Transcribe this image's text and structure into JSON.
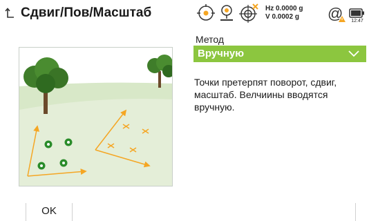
{
  "header": {
    "title": "Сдвиг/Пов/Масштаб",
    "hz_line": "Hz 0.0000 g",
    "v_line": "V  0.0002 g",
    "battery_time": "12:47",
    "icons": [
      "back-icon",
      "level-bubble-icon",
      "reflector-icon",
      "target-lock-icon",
      "at-signal-icon",
      "battery-icon"
    ]
  },
  "method": {
    "label": "Метод",
    "value": "Вручную"
  },
  "description": "Точки претерпят поворот, сдвиг, масштаб. Велчиины вводятся вручную.",
  "softkeys": {
    "ok": "OK"
  },
  "colors": {
    "accent_green": "#8cc63f",
    "arrow_orange": "#f5a623",
    "warning_orange": "#f5a623"
  }
}
